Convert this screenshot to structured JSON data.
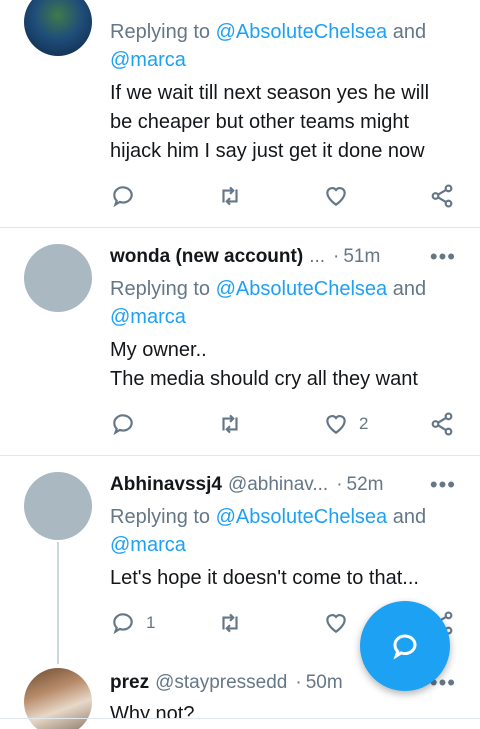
{
  "tweets": [
    {
      "reply_prefix": "Replying to ",
      "mention1": "@AbsoluteChelsea",
      "and": " and",
      "mention2": "@marca",
      "text_lines": [
        "If we wait till next season yes he will",
        "be cheaper but other teams might",
        "hijack him I say just get it done now"
      ],
      "reply_count": "",
      "like_count": ""
    },
    {
      "name": "wonda (new account)",
      "handle": "...",
      "separator": "·",
      "time": "51m",
      "more": "•••",
      "reply_prefix": "Replying to ",
      "mention1": "@AbsoluteChelsea",
      "and": " and",
      "mention2": "@marca",
      "text_lines": [
        "My owner..",
        "The media should cry all they want"
      ],
      "reply_count": "",
      "like_count": "2"
    },
    {
      "name": "Abhinavssj4",
      "handle": "@abhinav...",
      "separator": "·",
      "time": "52m",
      "more": "•••",
      "reply_prefix": "Replying to ",
      "mention1": "@AbsoluteChelsea",
      "and": " and",
      "mention2": "@marca",
      "text_lines": [
        "Let's hope it doesn't come to that..."
      ],
      "reply_count": "1",
      "like_count": ""
    },
    {
      "name": "prez",
      "handle": "@staypressedd",
      "separator": "·",
      "time": "50m",
      "more": "•••",
      "text_lines": [
        "Why not?"
      ]
    }
  ],
  "icons": {
    "reply": "reply-icon",
    "retweet": "retweet-icon",
    "like": "heart-icon",
    "share": "share-icon",
    "compose": "compose-reply-icon"
  },
  "colors": {
    "accent": "#1da1f2",
    "muted": "#657786",
    "divider": "#e1e8ed"
  }
}
